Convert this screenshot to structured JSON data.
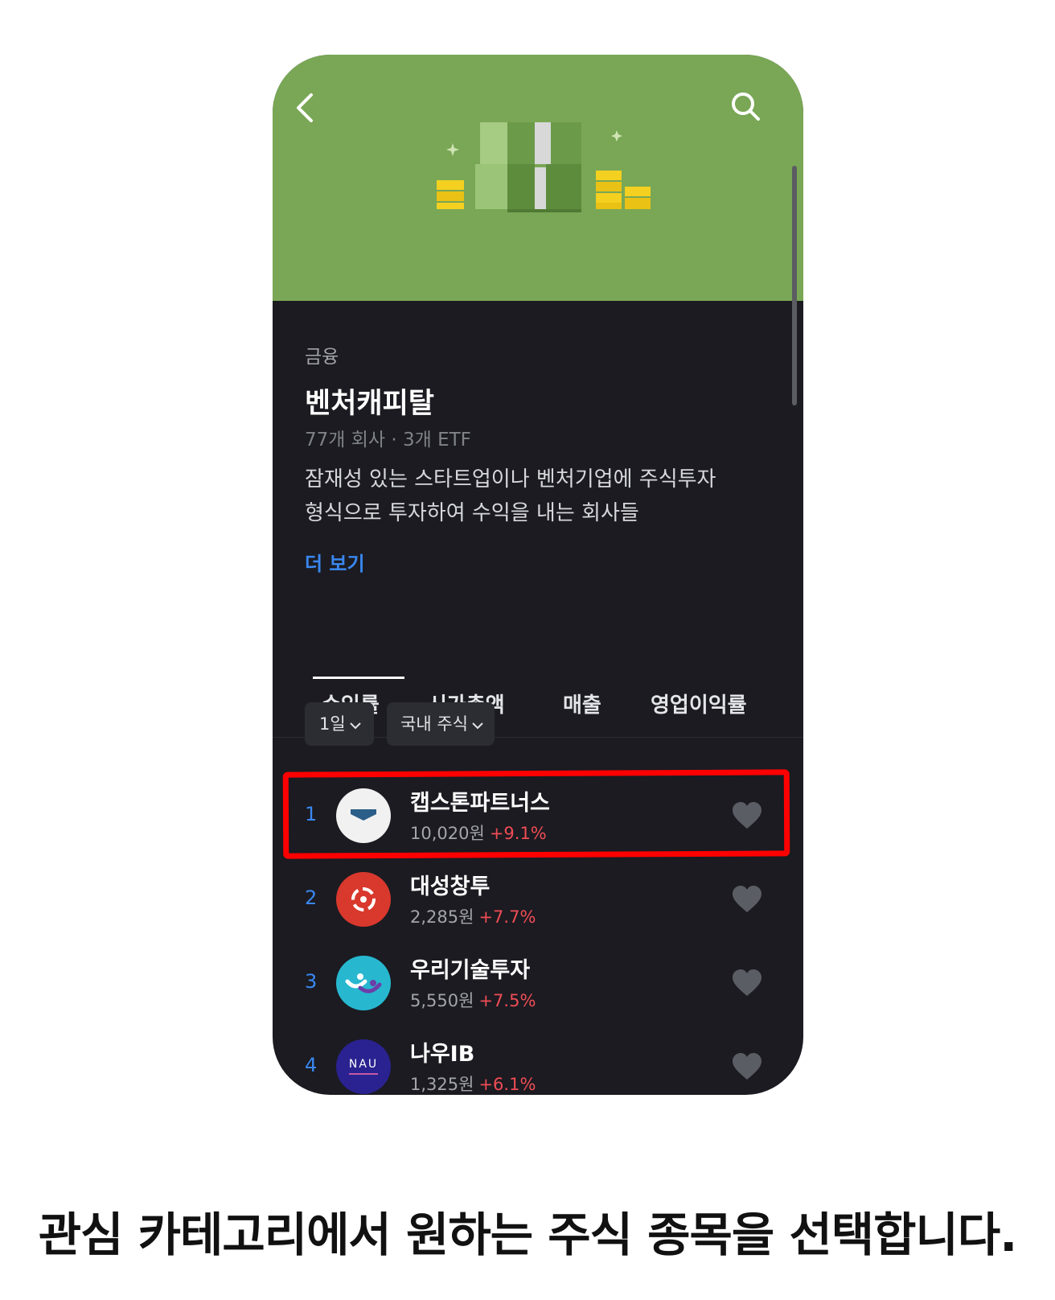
{
  "header": {
    "category": "금융",
    "title": "벤처캐피탈",
    "counts": "77개 회사 · 3개 ETF",
    "description_line1": "잠재성 있는 스타트업이나 벤처기업에 주식투자",
    "description_line2": "형식으로 투자하여 수익을 내는 회사들",
    "more_label": "더 보기"
  },
  "colors": {
    "hero_bg": "#79a755",
    "page_bg": "#1b1b21",
    "accent_blue": "#3a87f0",
    "gain_red": "#f04c55",
    "highlight_red": "#ff0000"
  },
  "tabs": [
    {
      "label": "수익률",
      "active": true
    },
    {
      "label": "시가총액",
      "active": false
    },
    {
      "label": "매출",
      "active": false
    },
    {
      "label": "영업이익률",
      "active": false
    }
  ],
  "filters": {
    "period": "1일",
    "market": "국내 주식"
  },
  "stocks": [
    {
      "rank": "1",
      "name": "캡스톤파트너스",
      "price": "10,020원",
      "change": "+9.1%",
      "logo_icon": "capstone-logo-icon"
    },
    {
      "rank": "2",
      "name": "대성창투",
      "price": "2,285원",
      "change": "+7.7%",
      "logo_icon": "daesung-logo-icon"
    },
    {
      "rank": "3",
      "name": "우리기술투자",
      "price": "5,550원",
      "change": "+7.5%",
      "logo_icon": "woori-logo-icon"
    },
    {
      "rank": "4",
      "name": "나우IB",
      "price": "1,325원",
      "change": "+6.1%",
      "logo_icon": "nau-logo-icon",
      "logo_text": "NAU"
    }
  ],
  "caption": "관심 카테고리에서 원하는 주식 종목을 선택합니다."
}
